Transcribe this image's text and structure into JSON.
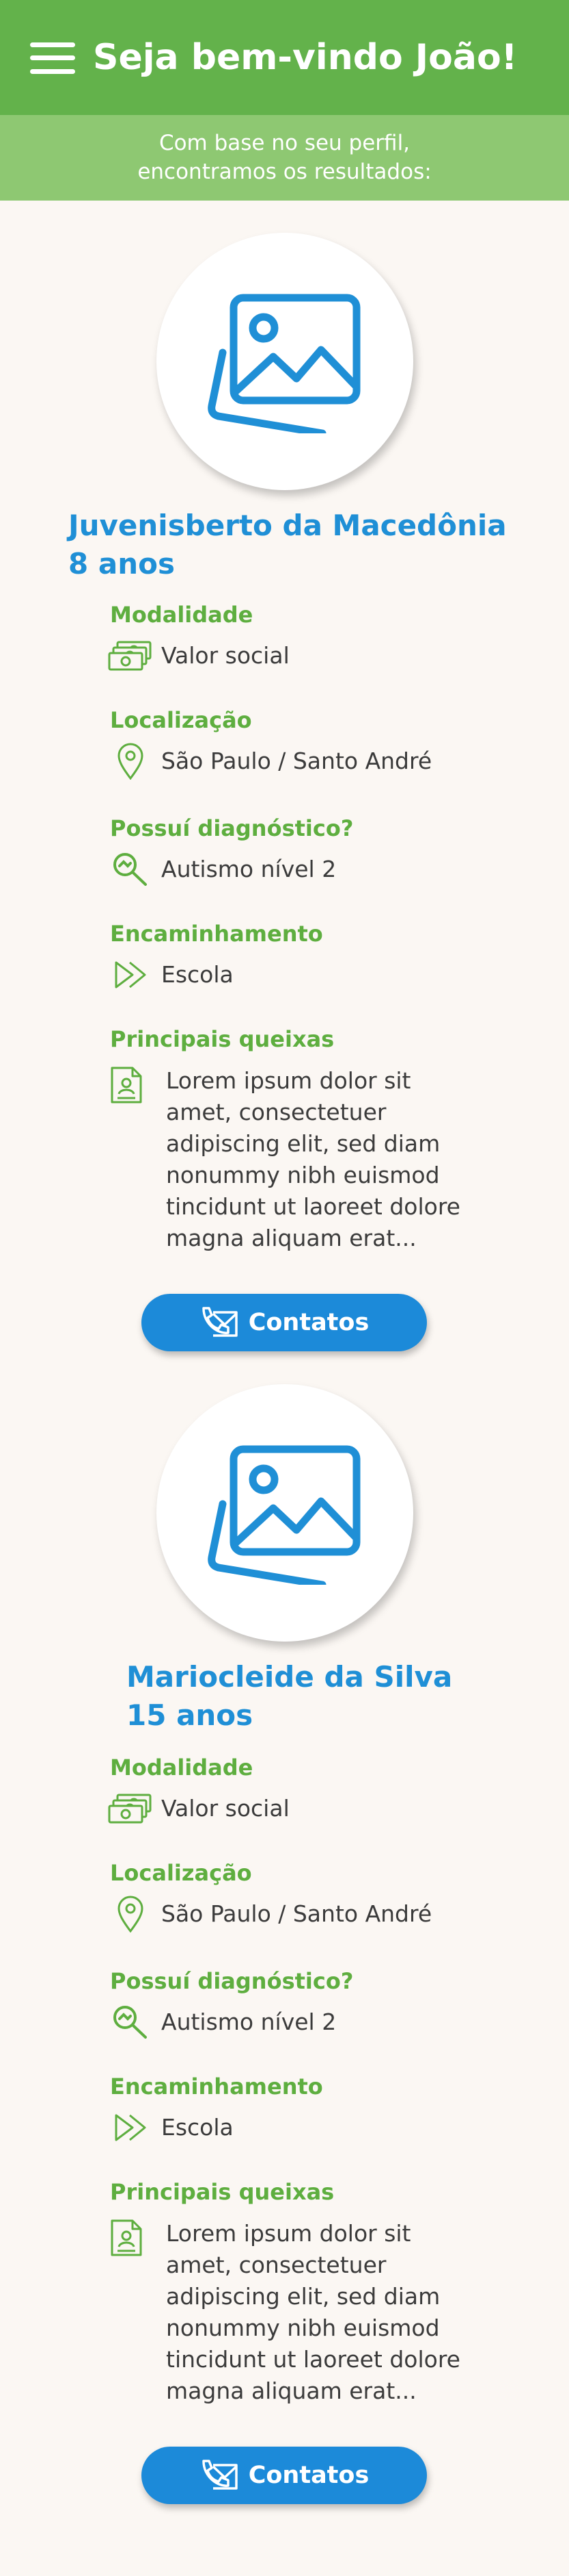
{
  "header": {
    "menu_icon": "menu-icon",
    "title": "Seja bem-vindo João!",
    "subtitle_line1": "Com base no seu perfil,",
    "subtitle_line2": "encontramos os resultados:"
  },
  "colors": {
    "header_green": "#63b24b",
    "subheader_green": "#8ec872",
    "label_green": "#5eae3f",
    "name_blue": "#1f8fd6",
    "button_blue": "#1c8ad9",
    "background": "#fbf7f3"
  },
  "labels": {
    "modality": "Modalidade",
    "location": "Localização",
    "diagnosis": "Possuí diagnóstico?",
    "referral": "Encaminhamento",
    "complaints": "Principais queixas",
    "contact_button": "Contatos"
  },
  "icons": {
    "avatar": "image-placeholder-icon",
    "modality": "money-stack-icon",
    "location": "location-pin-icon",
    "diagnosis": "magnifier-icon",
    "referral": "double-arrow-icon",
    "complaints": "document-icon",
    "contact": "phone-envelope-icon"
  },
  "results": [
    {
      "name_line1": "Juvenisberto da Macedônia",
      "name_line2": "8 anos",
      "modality": "Valor social",
      "location": "São Paulo / Santo André",
      "diagnosis": "Autismo nível 2",
      "referral": "Escola",
      "complaints": [
        "Lorem ipsum dolor sit",
        "amet, consectetuer",
        "adipiscing elit, sed diam",
        "nonummy nibh euismod",
        "tincidunt ut laoreet dolore",
        "magna aliquam erat..."
      ]
    },
    {
      "name_line1": "Mariocleide da Silva",
      "name_line2": "15 anos",
      "modality": "Valor social",
      "location": "São Paulo / Santo André",
      "diagnosis": "Autismo nível 2",
      "referral": "Escola",
      "complaints": [
        "Lorem ipsum dolor sit",
        "amet, consectetuer",
        "adipiscing elit, sed diam",
        "nonummy nibh euismod",
        "tincidunt ut laoreet dolore",
        "magna aliquam erat..."
      ]
    }
  ]
}
